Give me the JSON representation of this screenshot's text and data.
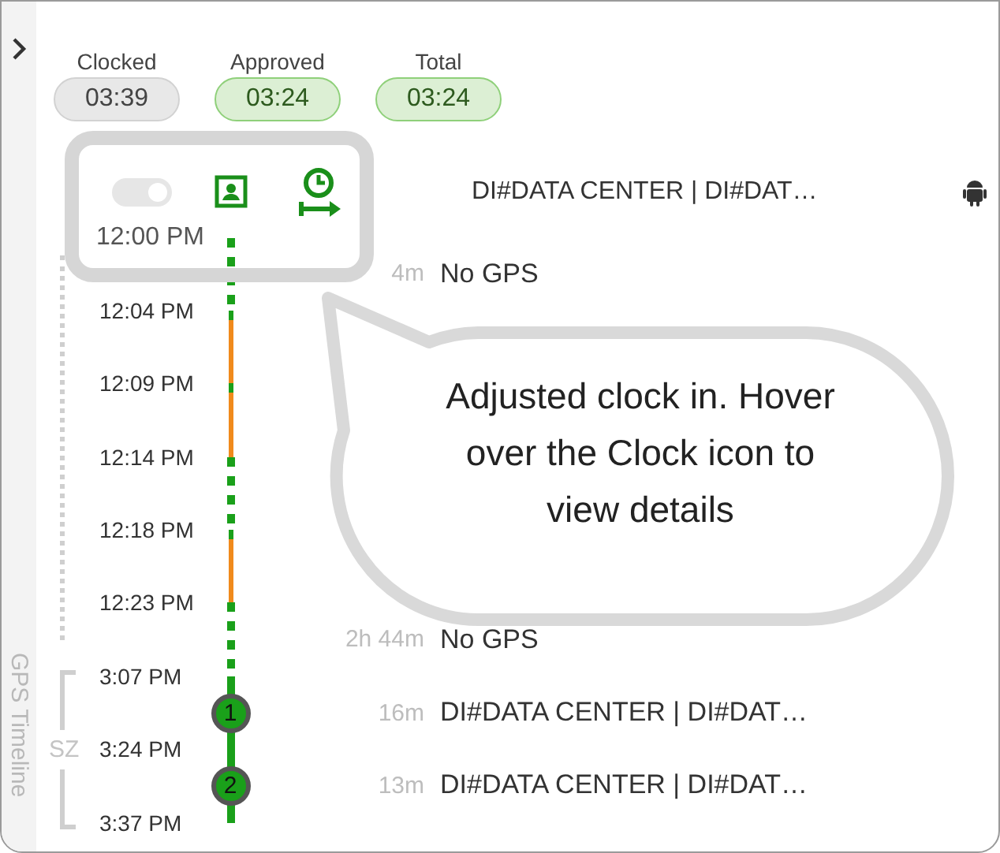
{
  "side_panel": {
    "title": "GPS Timeline"
  },
  "summary": [
    {
      "label": "Clocked",
      "value": "03:39",
      "approved": false
    },
    {
      "label": "Approved",
      "value": "03:24",
      "approved": true
    },
    {
      "label": "Total",
      "value": "03:24",
      "approved": true
    }
  ],
  "clock_in": {
    "toggle_on": true,
    "toggle_disabled": true,
    "location": "DI#DATA CENTER | DI#DAT…"
  },
  "timeline": [
    {
      "kind": "time",
      "time": "12:00 PM",
      "segment": {
        "kind": "gps-gap"
      }
    },
    {
      "kind": "event",
      "duration": "4m",
      "place": "No GPS"
    },
    {
      "kind": "time",
      "time": "12:04 PM",
      "segment": {
        "kind": "moving"
      }
    },
    {
      "kind": "time",
      "time": "12:09 PM",
      "segment": {
        "kind": "moving"
      }
    },
    {
      "kind": "time",
      "time": "12:14 PM",
      "segment": {
        "kind": "gps-gap"
      }
    },
    {
      "kind": "time",
      "time": "12:18 PM",
      "segment": {
        "kind": "moving"
      }
    },
    {
      "kind": "time",
      "time": "12:23 PM",
      "segment": {
        "kind": "gps-gap"
      }
    },
    {
      "kind": "event",
      "duration": "2h 44m",
      "place": "No GPS"
    },
    {
      "kind": "time",
      "time": "3:07 PM",
      "segment": {
        "kind": "stop"
      }
    },
    {
      "kind": "event",
      "duration": "16m",
      "place": "DI#DATA CENTER | DI#DAT…",
      "marker": "1"
    },
    {
      "kind": "time",
      "time": "3:24 PM",
      "segment": {
        "kind": "stop"
      }
    },
    {
      "kind": "event",
      "duration": "13m",
      "place": "DI#DATA CENTER | DI#DAT…",
      "marker": "2"
    },
    {
      "kind": "time",
      "time": "3:37 PM"
    }
  ],
  "zone_label": "SZ",
  "callout": {
    "text": "Adjusted clock in. Hover over the Clock icon to view details"
  }
}
